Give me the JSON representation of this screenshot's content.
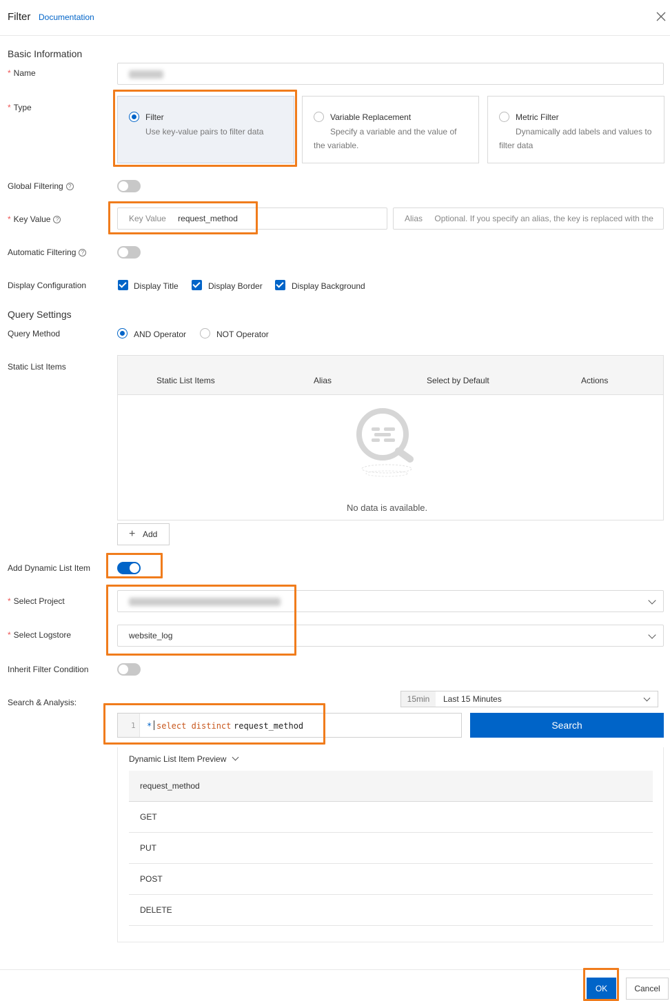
{
  "header": {
    "title": "Filter",
    "doc_link": "Documentation"
  },
  "basic_info": {
    "section_title": "Basic Information",
    "name_label": "Name",
    "type_label": "Type",
    "types": [
      {
        "title": "Filter",
        "desc": "Use key-value pairs to filter data",
        "selected": true
      },
      {
        "title": "Variable Replacement",
        "desc": "Specify a variable and the value of the variable.",
        "selected": false
      },
      {
        "title": "Metric Filter",
        "desc": "Dynamically add labels and values to filter data",
        "selected": false
      }
    ],
    "global_filtering_label": "Global Filtering",
    "key_value_label": "Key Value",
    "key_value_prefix": "Key Value",
    "key_value_value": "request_method",
    "alias_prefix": "Alias",
    "alias_placeholder": "Optional. If you specify an alias, the key is replaced with the",
    "auto_filtering_label": "Automatic Filtering",
    "display_config_label": "Display Configuration",
    "display_options": [
      "Display Title",
      "Display Border",
      "Display Background"
    ]
  },
  "query_settings": {
    "section_title": "Query Settings",
    "query_method_label": "Query Method",
    "methods": [
      "AND Operator",
      "NOT Operator"
    ],
    "static_list_label": "Static List Items",
    "table_headers": [
      "Static List Items",
      "Alias",
      "Select by Default",
      "Actions"
    ],
    "empty_text": "No data is available.",
    "add_button": "Add",
    "dynamic_label": "Add Dynamic List Item",
    "select_project_label": "Select Project",
    "select_logstore_label": "Select Logstore",
    "logstore_value": "website_log",
    "inherit_label": "Inherit Filter Condition",
    "search_analysis_label": "Search & Analysis:",
    "time_badge": "15min",
    "time_range": "Last 15 Minutes",
    "line_number": "1",
    "query_star": "*",
    "query_keywords": "select distinct",
    "query_field": "request_method",
    "search_button": "Search",
    "preview_title": "Dynamic List Item Preview",
    "preview_header": "request_method",
    "preview_rows": [
      "GET",
      "PUT",
      "POST",
      "DELETE"
    ]
  },
  "footer": {
    "ok": "OK",
    "cancel": "Cancel"
  },
  "colors": {
    "primary": "#0064c8",
    "highlight": "#f07c1c"
  }
}
